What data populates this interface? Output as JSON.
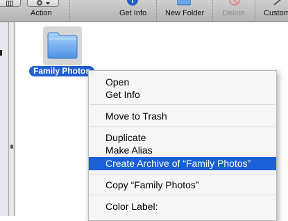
{
  "toolbar": {
    "action_label": "Action",
    "get_info_label": "Get Info",
    "new_folder_label": "New Folder",
    "delete_label": "Delete",
    "customize_label": "Custom"
  },
  "icons": {
    "view": "view-icon",
    "action": "gear-icon",
    "get_info": "info-icon",
    "new_folder": "new-folder-icon",
    "delete": "delete-icon",
    "customize": "customize-icon",
    "folder": "folder-icon"
  },
  "colors": {
    "selection": "#1b5fd6",
    "info_blue": "#1f5fd0",
    "delete_red": "#d44"
  },
  "folder": {
    "name": "Family Photos"
  },
  "context_menu": {
    "items": [
      {
        "label": "Open"
      },
      {
        "label": "Get Info"
      },
      {
        "label": "Move to Trash"
      },
      {
        "label": "Duplicate"
      },
      {
        "label": "Make Alias"
      },
      {
        "label": "Create Archive of “Family Photos”",
        "highlighted": true
      },
      {
        "label": "Copy “Family Photos”"
      },
      {
        "label": "Color Label:"
      }
    ]
  }
}
